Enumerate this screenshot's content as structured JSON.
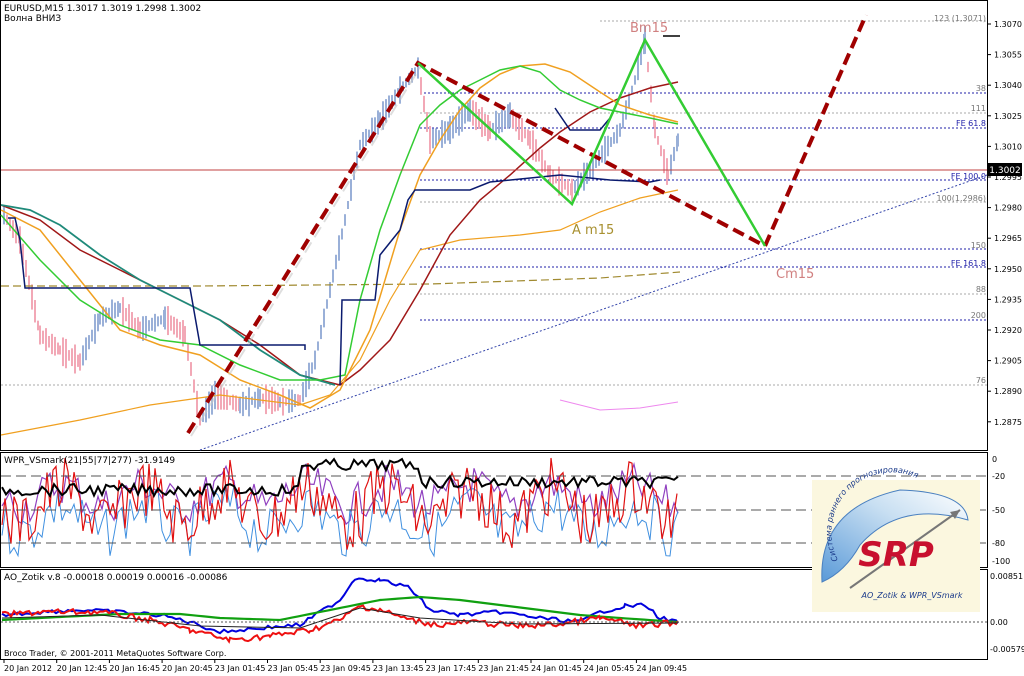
{
  "window": {
    "symbol_info": "EURUSD,M15  1.3017 1.3019 1.2998 1.3002",
    "comment": "Волна ВНИЗ",
    "copyright": "Broco Trader, © 2001-2011 MetaQuotes Software Corp."
  },
  "price_axis": {
    "ticks": [
      "1.3070",
      "1.3055",
      "1.3040",
      "1.3025",
      "1.3010",
      "1.2995",
      "1.2980",
      "1.2965",
      "1.2950",
      "1.2935",
      "1.2920",
      "1.2905",
      "1.2890",
      "1.2875"
    ],
    "current_price": "1.3002"
  },
  "fib_levels": {
    "l123": "123 (1.3071)",
    "l38": "38",
    "l111": "111",
    "fe618": "FE 61.8",
    "fe100": "FE 100.0",
    "l100": "100(1.2986)",
    "l150": "150",
    "fe1618": "FE 161.8",
    "l88": "88",
    "l200": "200",
    "l76": "76"
  },
  "wave_labels": {
    "b": "Bm15",
    "a": "A m15",
    "c": "Cm15"
  },
  "wpr": {
    "title": "WPR_VSmark(21|55|77|277) -31.9149",
    "levels": [
      "0",
      "-20",
      "-50",
      "-80",
      "-100"
    ]
  },
  "ao": {
    "title": "AO_Zotik v.8 -0.00018 0.00019 0.00016 -0.00086",
    "levels": [
      "0.00851",
      "0.00",
      "-0.00579"
    ]
  },
  "time_axis": {
    "ticks": [
      "20 Jan 2012",
      "20 Jan 12:45",
      "20 Jan 16:45",
      "20 Jan 20:45",
      "23 Jan 01:45",
      "23 Jan 05:45",
      "23 Jan 09:45",
      "23 Jan 13:45",
      "23 Jan 17:45",
      "23 Jan 21:45",
      "24 Jan 01:45",
      "24 Jan 05:45",
      "24 Jan 09:45"
    ]
  },
  "logo": {
    "text": "SRP",
    "arc_text": "Система раннего прогнозирования",
    "bottom_text": "AO_Zotik & WPR_VSmark"
  },
  "colors": {
    "bull_bar": "#9ab0d8",
    "bear_bar": "#f2a8b6",
    "wave_dashed": "#a00000",
    "green_line": "#33cc33",
    "navy_line": "#0a1a6e",
    "orange_ma": "#f0a020",
    "maroon_ma": "#a01818",
    "teal_ma": "#1f8a7a",
    "olive_dashed": "#a08a30",
    "fib_blue": "#2222aa",
    "price_line": "#c04040",
    "wpr_black": "#000000",
    "wpr_red": "#e01010",
    "wpr_purple": "#9040c0",
    "wpr_blue": "#4090e0",
    "ao_blue": "#0000dd",
    "ao_green": "#10a010",
    "ao_red": "#ee1010",
    "logo_red": "#c8102e"
  }
}
